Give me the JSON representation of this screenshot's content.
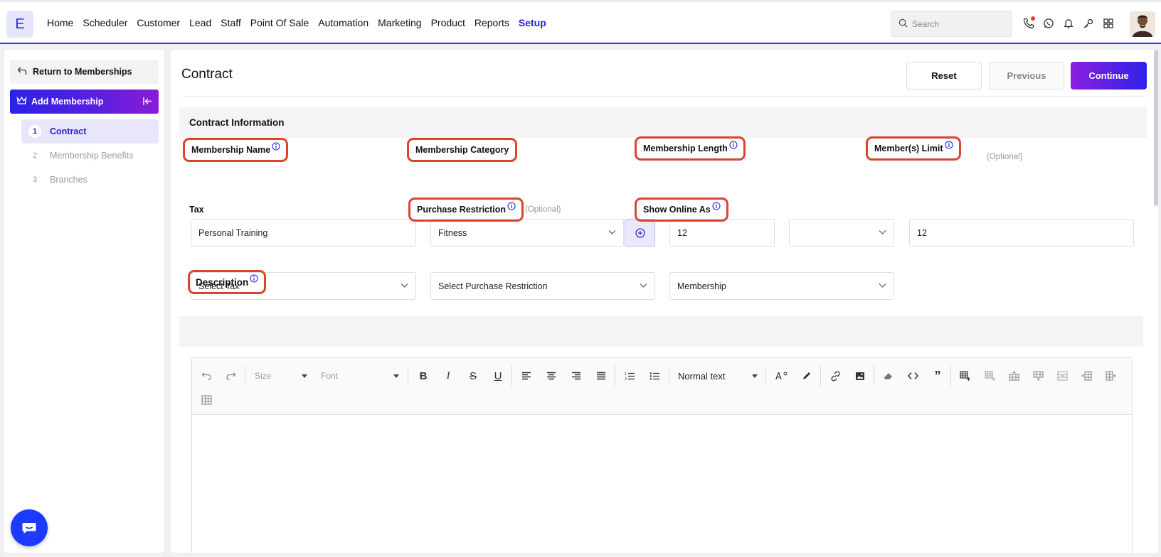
{
  "app": {
    "logo_letter": "E"
  },
  "nav": {
    "items": [
      "Home",
      "Scheduler",
      "Customer",
      "Lead",
      "Staff",
      "Point Of Sale",
      "Automation",
      "Marketing",
      "Product",
      "Reports",
      "Setup"
    ],
    "active": "Setup"
  },
  "search": {
    "placeholder": "Search"
  },
  "top_icons": [
    "phone-icon",
    "whatsapp-icon",
    "bell-icon",
    "key-icon",
    "apps-grid-icon"
  ],
  "sidebar": {
    "return_label": "Return to Memberships",
    "section_label": "Add Membership",
    "steps": [
      {
        "num": "1",
        "label": "Contract",
        "active": true
      },
      {
        "num": "2",
        "label": "Membership Benefits",
        "active": false
      },
      {
        "num": "3",
        "label": "Branches",
        "active": false
      }
    ]
  },
  "page": {
    "title": "Contract",
    "buttons": {
      "reset": "Reset",
      "previous": "Previous",
      "continue": "Continue"
    }
  },
  "contract_info": {
    "heading": "Contract Information",
    "membership_name": {
      "label": "Membership Name",
      "value": "Personal Training"
    },
    "membership_category": {
      "label": "Membership Category",
      "value": "Fitness"
    },
    "membership_length": {
      "label": "Membership Length",
      "value": "12",
      "unit": ""
    },
    "members_limit": {
      "label": "Member(s) Limit",
      "optional": "(Optional)",
      "value": "12"
    },
    "tax": {
      "label": "Tax",
      "value": "Select Tax"
    },
    "purchase_restriction": {
      "label": "Purchase Restriction",
      "optional": "(Optional)",
      "value": "Select Purchase Restriction"
    },
    "show_online_as": {
      "label": "Show Online As",
      "value": "Membership"
    }
  },
  "description": {
    "label": "Description",
    "toolbar": {
      "size": "Size",
      "font": "Font",
      "block_format": "Normal text"
    }
  },
  "colors": {
    "accent": "#2b22e6",
    "highlight": "#d9442f",
    "gradient_end": "#8a1cd6"
  }
}
